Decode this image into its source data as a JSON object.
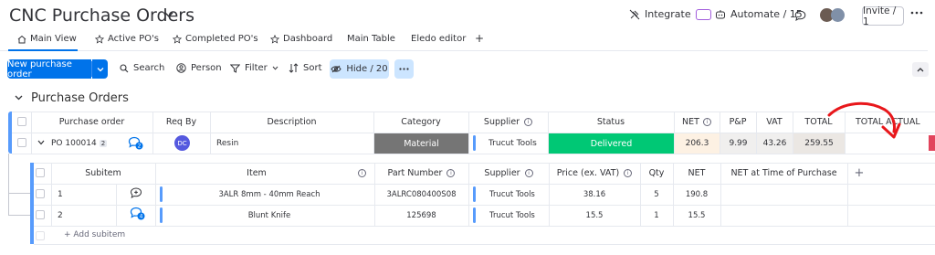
{
  "header": {
    "title": "CNC Purchase Orders",
    "integrate_label": "Integrate",
    "automate_label": "Automate / 15",
    "invite_label": "Invite / 1"
  },
  "tabs": [
    {
      "label": "Main View",
      "icon": "home-icon",
      "active": true
    },
    {
      "label": "Active PO's",
      "icon": "star-icon"
    },
    {
      "label": "Completed PO's",
      "icon": "star-icon"
    },
    {
      "label": "Dashboard",
      "icon": "star-icon"
    },
    {
      "label": "Main Table"
    },
    {
      "label": "Eledo editor"
    },
    {
      "label": "+",
      "icon": "plus-icon"
    }
  ],
  "toolbar": {
    "new_label": "New purchase order",
    "search_label": "Search",
    "person_label": "Person",
    "filter_label": "Filter",
    "sort_label": "Sort",
    "hide_label": "Hide / 20"
  },
  "group": {
    "title": "Purchase Orders",
    "color": "#579bfc"
  },
  "main_table": {
    "headers": {
      "purchase_order": "Purchase order",
      "req_by": "Req By",
      "description": "Description",
      "category": "Category",
      "supplier": "Supplier",
      "status": "Status",
      "net": "NET",
      "pp": "P&P",
      "vat": "VAT",
      "total": "TOTAL",
      "total_actual": "TOTAL ACTUAL"
    },
    "row": {
      "purchase_order": "PO 100014",
      "subitem_count": "2",
      "update_count": "2",
      "req_by_initials": "DC",
      "description": "Resin",
      "category": "Material",
      "category_color": "#757575",
      "supplier": "Trucut Tools",
      "status": "Delivered",
      "status_color": "#00c875",
      "net": "206.3",
      "pp": "9.99",
      "vat": "43.26",
      "total": "259.55",
      "total_actual": ""
    }
  },
  "subitems": {
    "headers": {
      "subitem": "Subitem",
      "item": "Item",
      "part_number": "Part Number",
      "supplier": "Supplier",
      "price": "Price (ex. VAT)",
      "qty": "Qty",
      "net": "NET",
      "net_at_purchase": "NET at Time of Purchase"
    },
    "rows": [
      {
        "subitem": "1",
        "item": "3ALR 8mm - 40mm Reach",
        "part_number": "3ALRC080400S08",
        "supplier": "Trucut Tools",
        "price": "38.16",
        "qty": "5",
        "net": "190.8",
        "updates": ""
      },
      {
        "subitem": "2",
        "item": "Blunt Knife",
        "part_number": "125698",
        "supplier": "Trucut Tools",
        "price": "15.5",
        "qty": "1",
        "net": "15.5",
        "updates": "4"
      }
    ],
    "add_label": "+ Add subitem"
  },
  "annotation_color": "#e8171b"
}
